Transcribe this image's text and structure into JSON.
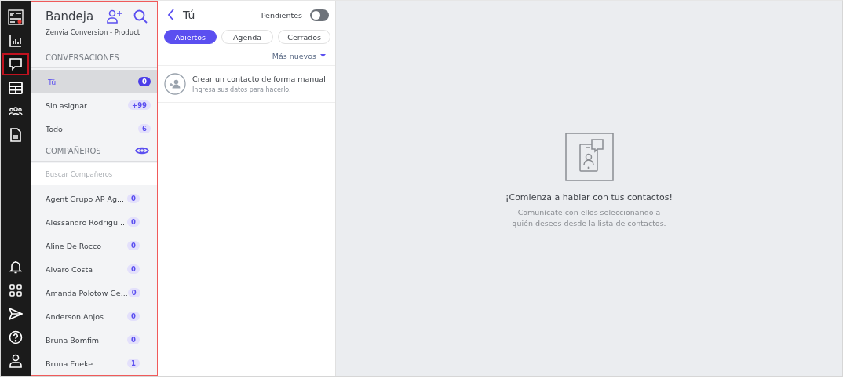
{
  "rail": {
    "top": [
      {
        "kind": "logo",
        "selected": false
      },
      {
        "kind": "chart",
        "selected": false
      },
      {
        "kind": "chat",
        "selected": true
      },
      {
        "kind": "table",
        "selected": false
      },
      {
        "kind": "people",
        "selected": false
      },
      {
        "kind": "doc",
        "selected": false
      }
    ],
    "bottom": [
      {
        "kind": "bell",
        "selected": false
      },
      {
        "kind": "grid",
        "selected": false
      },
      {
        "kind": "send",
        "selected": false
      },
      {
        "kind": "help",
        "selected": false
      },
      {
        "kind": "user",
        "selected": false
      }
    ]
  },
  "inbox": {
    "title": "Bandeja",
    "subtitle": "Zenvia Conversion - Product",
    "conversations_heading": "CONVERSACIONES",
    "conversations": [
      {
        "label": "Tú",
        "count": "0",
        "selected": true
      },
      {
        "label": "Sin asignar",
        "count": "+99",
        "selected": false
      },
      {
        "label": "Todo",
        "count": "6",
        "selected": false
      }
    ],
    "teammates_heading": "COMPAÑEROS",
    "search_placeholder": "Buscar Compañeros",
    "teammates": [
      {
        "name": "Agent Grupo AP Ag...",
        "count": "0"
      },
      {
        "name": "Alessandro Rodrigu...",
        "count": "0"
      },
      {
        "name": "Aline De Rocco",
        "count": "0"
      },
      {
        "name": "Alvaro Costa",
        "count": "0"
      },
      {
        "name": "Amanda Polotow Ge...",
        "count": "0"
      },
      {
        "name": "Anderson Anjos",
        "count": "0"
      },
      {
        "name": "Bruna Bomfim",
        "count": "0"
      },
      {
        "name": "Bruna Eneke",
        "count": "1"
      }
    ]
  },
  "list": {
    "title": "Tú",
    "pending_label": "Pendientes",
    "pending_on": false,
    "filters": [
      {
        "label": "Abiertos",
        "selected": true
      },
      {
        "label": "Agenda",
        "selected": false
      },
      {
        "label": "Cerrados",
        "selected": false
      }
    ],
    "sort": "Más nuevos",
    "create": {
      "title": "Crear un contacto de forma manual",
      "subtitle": "Ingresa sus datos para hacerlo."
    }
  },
  "empty": {
    "title": "¡Comienza a hablar con tus contactos!",
    "text": "Comunícate con ellos seleccionando a quién desees desde la lista de contactos."
  }
}
